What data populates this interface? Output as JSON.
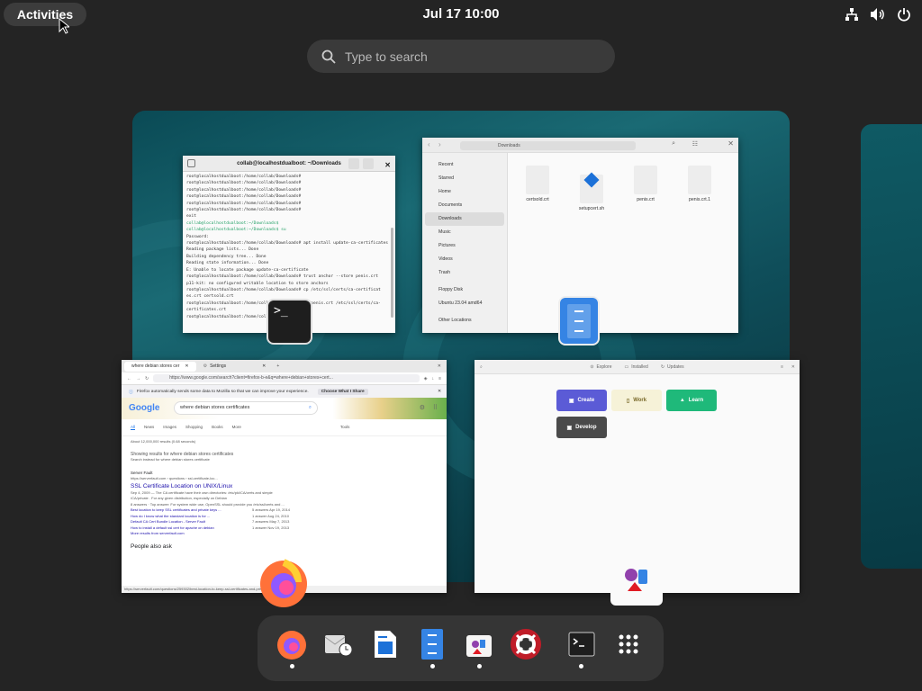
{
  "topbar": {
    "activities_label": "Activities",
    "clock": "Jul 17  10:00",
    "tray_icons": [
      "network-icon",
      "volume-icon",
      "power-icon"
    ]
  },
  "search": {
    "placeholder": "Type to search"
  },
  "terminal_window": {
    "title": "collab@localhostdualboot: ~/Downloads",
    "lines": [
      "root@localhostdualboot:/home/collab/Downloads#",
      "root@localhostdualboot:/home/collab/Downloads#",
      "root@localhostdualboot:/home/collab/Downloads#",
      "root@localhostdualboot:/home/collab/Downloads#",
      "root@localhostdualboot:/home/collab/Downloads#",
      "root@localhostdualboot:/home/collab/Downloads#",
      "exit",
      "collab@localhostdualboot:~/Downloads$",
      "collab@localhostdualboot:~/Downloads$ su",
      "Password:",
      "root@localhostdualboot:/home/collab/Downloads# apt install update-ca-certificates",
      "Reading package lists... Done",
      "Building dependency tree... Done",
      "Reading state information... Done",
      "E: Unable to locate package update-ca-certificate",
      "root@localhostdualboot:/home/collab/Downloads# trust anchor --store penis.crt",
      "p11-kit: no configured writable location to store anchors",
      "root@localhostdualboot:/home/collab/Downloads# cp /etc/ssl/certs/ca-certificat",
      "es.crt certsold.crt",
      "root@localhostdualboot:/home/collab/Downloads# cp penis.crt /etc/ssl/certs/ca-",
      "certificates.crt",
      "root@localhostdualboot:/home/collab/Downloads#"
    ]
  },
  "files_window": {
    "path": "Downloads",
    "sidebar": [
      "Recent",
      "Starred",
      "Home",
      "Documents",
      "Downloads",
      "Music",
      "Pictures",
      "Videos",
      "Trash",
      "Floppy Disk",
      "Ubuntu 23.04 amd64",
      "Other Locations"
    ],
    "selected": "Downloads",
    "files": [
      "certsold.crt",
      "setupcert.sh",
      "penis.crt",
      "penis.crt.1"
    ]
  },
  "firefox_window": {
    "tabs": [
      "where debian stores cer",
      "Settings"
    ],
    "url": "https://www.google.com/search?client=firefox-b-e&q=where+debian+stores+cert...",
    "notice": "Firefox automatically sends some data to Mozilla so that we can improve your experience.",
    "notice_button": "Choose What I Share",
    "search_query": "where debian stores certificates",
    "google_label": "Google",
    "search_tabs": [
      "All",
      "News",
      "Images",
      "Shopping",
      "Books",
      "More",
      "Tools"
    ],
    "result_count": "About 12,000,000 results (0.68 seconds)",
    "showing_results": "Showing results for where debian stores certificates",
    "search_instead": "Search instead for where debian stores certificate",
    "result_site": "Server Fault",
    "result_url": "https://serverfault.com › questions › ssl-certificate-loc...",
    "result_title": "SSL Certificate Location on UNIX/Linux",
    "result_snippet_1": "Sep 4, 2009 — The CA certificate have their own directories: /etc/pki/CA/certs and simple",
    "result_snippet_2": "/CA/private . For any given distribution, especially on Debian",
    "result_snippet_3": "8 answers · Top answer: For system wide use, OpenSSL should provide you /etc/ssl/certs and ...",
    "sub_results": [
      {
        "title": "Best location to keep SSL certificates and private keys ...",
        "meta": "5 answers   Apr 19, 2014"
      },
      {
        "title": "How do I know what the standard location is for ...",
        "meta": "1 answer    Aug 24, 2010"
      },
      {
        "title": "Default CA Cert Bundle Location - Server Fault",
        "meta": "7 answers   May 7, 2013"
      },
      {
        "title": "How to install a default ssl cert for apache on debian",
        "meta": "1 answer    Nov 19, 2013"
      }
    ],
    "more_results": "More results from serverfault.com",
    "people_also_ask": "People also ask",
    "status_url": "https://serverfault.com/questions/259302/best-location-to-keep-ssl-certificates-and-private-keys-on-ubuntu-servers"
  },
  "software_window": {
    "tabs": [
      "Explore",
      "Installed",
      "Updates"
    ],
    "tiles": [
      "Create",
      "Work",
      "Learn",
      "Develop"
    ]
  },
  "dock": {
    "apps": [
      "firefox-icon",
      "mail-clock-icon",
      "writer-icon",
      "files-icon",
      "software-icon",
      "help-icon",
      "terminal-icon",
      "app-grid-icon"
    ]
  },
  "colors": {
    "accent": "#26a269",
    "firefox_orange": "#ff7139",
    "files_blue": "#3584e4",
    "panel_bg": "#242424",
    "create_tile": "#5b5bd6",
    "learn_tile": "#1fb97a",
    "develop_tile": "#4a4a4a"
  }
}
